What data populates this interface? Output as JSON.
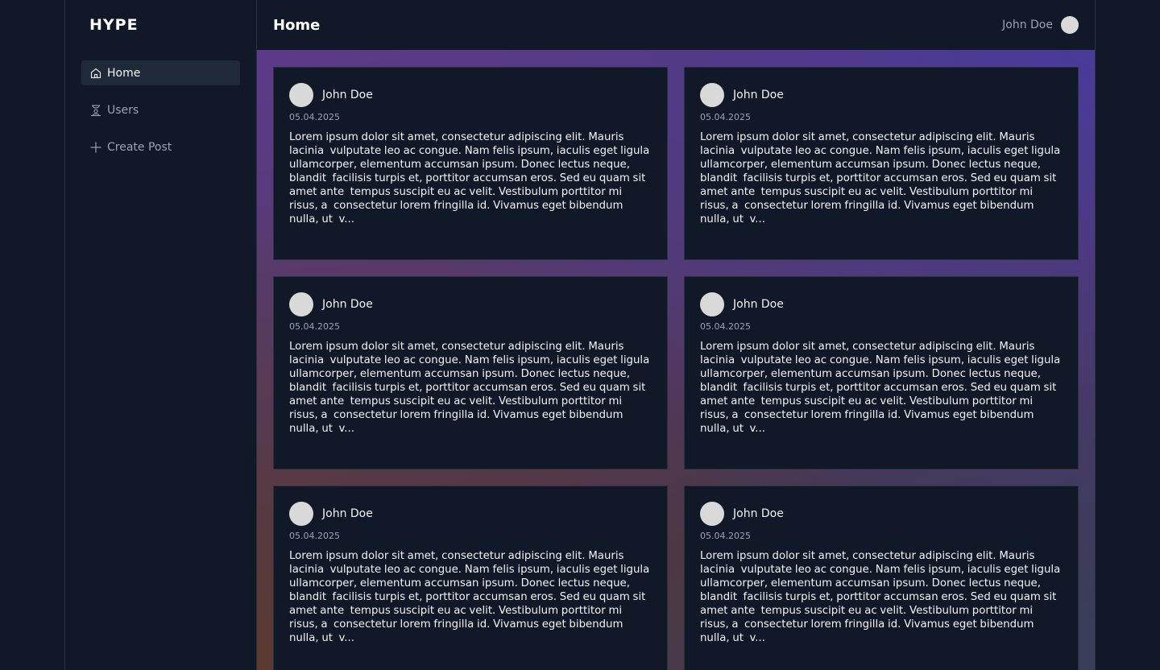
{
  "app": {
    "brand": "HYPE"
  },
  "sidebar": {
    "items": [
      {
        "label": "Home",
        "icon": "home-icon",
        "active": true
      },
      {
        "label": "Users",
        "icon": "users-icon",
        "active": false
      },
      {
        "label": "Create Post",
        "icon": "plus-icon",
        "active": false
      }
    ]
  },
  "header": {
    "title": "Home",
    "user_name": "John Doe"
  },
  "posts": [
    {
      "author": "John Doe",
      "date": "05.04.2025",
      "text": "Lorem ipsum dolor sit amet, consectetur adipiscing elit. Mauris lacinia  vulputate leo ac congue. Nam felis ipsum, iaculis eget ligula  ullamcorper, elementum accumsan ipsum. Donec lectus neque, blandit  facilisis turpis et, porttitor accumsan eros. Sed eu quam sit amet ante  tempus suscipit eu ac velit. Vestibulum porttitor mi risus, a  consectetur lorem fringilla id. Vivamus eget bibendum nulla, ut  v..."
    },
    {
      "author": "John Doe",
      "date": "05.04.2025",
      "text": "Lorem ipsum dolor sit amet, consectetur adipiscing elit. Mauris lacinia  vulputate leo ac congue. Nam felis ipsum, iaculis eget ligula  ullamcorper, elementum accumsan ipsum. Donec lectus neque, blandit  facilisis turpis et, porttitor accumsan eros. Sed eu quam sit amet ante  tempus suscipit eu ac velit. Vestibulum porttitor mi risus, a  consectetur lorem fringilla id. Vivamus eget bibendum nulla, ut  v..."
    },
    {
      "author": "John Doe",
      "date": "05.04.2025",
      "text": "Lorem ipsum dolor sit amet, consectetur adipiscing elit. Mauris lacinia  vulputate leo ac congue. Nam felis ipsum, iaculis eget ligula  ullamcorper, elementum accumsan ipsum. Donec lectus neque, blandit  facilisis turpis et, porttitor accumsan eros. Sed eu quam sit amet ante  tempus suscipit eu ac velit. Vestibulum porttitor mi risus, a  consectetur lorem fringilla id. Vivamus eget bibendum nulla, ut  v..."
    },
    {
      "author": "John Doe",
      "date": "05.04.2025",
      "text": "Lorem ipsum dolor sit amet, consectetur adipiscing elit. Mauris lacinia  vulputate leo ac congue. Nam felis ipsum, iaculis eget ligula  ullamcorper, elementum accumsan ipsum. Donec lectus neque, blandit  facilisis turpis et, porttitor accumsan eros. Sed eu quam sit amet ante  tempus suscipit eu ac velit. Vestibulum porttitor mi risus, a  consectetur lorem fringilla id. Vivamus eget bibendum nulla, ut  v..."
    },
    {
      "author": "John Doe",
      "date": "05.04.2025",
      "text": "Lorem ipsum dolor sit amet, consectetur adipiscing elit. Mauris lacinia  vulputate leo ac congue. Nam felis ipsum, iaculis eget ligula  ullamcorper, elementum accumsan ipsum. Donec lectus neque, blandit  facilisis turpis et, porttitor accumsan eros. Sed eu quam sit amet ante  tempus suscipit eu ac velit. Vestibulum porttitor mi risus, a  consectetur lorem fringilla id. Vivamus eget bibendum nulla, ut  v..."
    },
    {
      "author": "John Doe",
      "date": "05.04.2025",
      "text": "Lorem ipsum dolor sit amet, consectetur adipiscing elit. Mauris lacinia  vulputate leo ac congue. Nam felis ipsum, iaculis eget ligula  ullamcorper, elementum accumsan ipsum. Donec lectus neque, blandit  facilisis turpis et, porttitor accumsan eros. Sed eu quam sit amet ante  tempus suscipit eu ac velit. Vestibulum porttitor mi risus, a  consectetur lorem fringilla id. Vivamus eget bibendum nulla, ut  v..."
    }
  ]
}
